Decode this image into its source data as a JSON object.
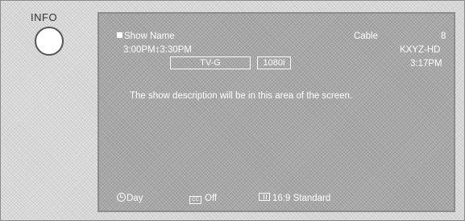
{
  "remote": {
    "info_label": "INFO"
  },
  "banner": {
    "show_name": "Show Name",
    "time_range": "3:00PM↕3:30PM",
    "source": "Cable",
    "channel_number": "8",
    "station": "KXYZ-HD",
    "current_time": "3:17PM",
    "rating": "TV-G",
    "resolution": "1080i",
    "description": "The show description will be in this area of the screen."
  },
  "bottom_bar": {
    "day_label": "Day",
    "cc_icon_text": "CC",
    "cc_label": "Off",
    "aspect_label": "16:9 Standard"
  },
  "icons": {
    "info_button": "circle-button-icon",
    "clock": "clock-icon",
    "closed_caption": "cc-icon",
    "aspect_ratio": "aspect-ratio-icon",
    "show_marker": "square-bullet-icon"
  },
  "colors": {
    "screen_background": "#a7a7a7",
    "text": "#ffffff",
    "frame_background": "#d6d6d6"
  }
}
